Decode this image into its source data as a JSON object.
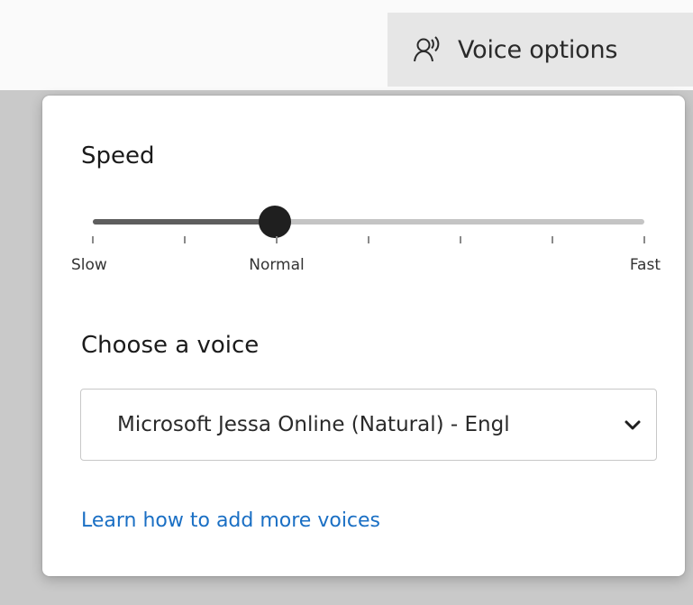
{
  "header": {
    "voice_options_label": "Voice options",
    "voice_options_icon": "voice-person-icon"
  },
  "flyout": {
    "speed_title": "Speed",
    "speed_slider": {
      "labels": [
        "Slow",
        "Normal",
        "Fast"
      ],
      "tick_count": 7,
      "value_fraction": 0.33
    },
    "voice_title": "Choose a voice",
    "voice_select": {
      "value": "Microsoft Jessa Online (Natural) - Engl",
      "icon": "chevron-down-icon"
    },
    "learn_link": "Learn how to add more voices"
  },
  "colors": {
    "link": "#1a6fc4",
    "slider_fill": "#5e5e5e",
    "slider_track": "#c4c4c4",
    "thumb": "#1f1f1f",
    "button_bg": "#e6e6e6"
  }
}
